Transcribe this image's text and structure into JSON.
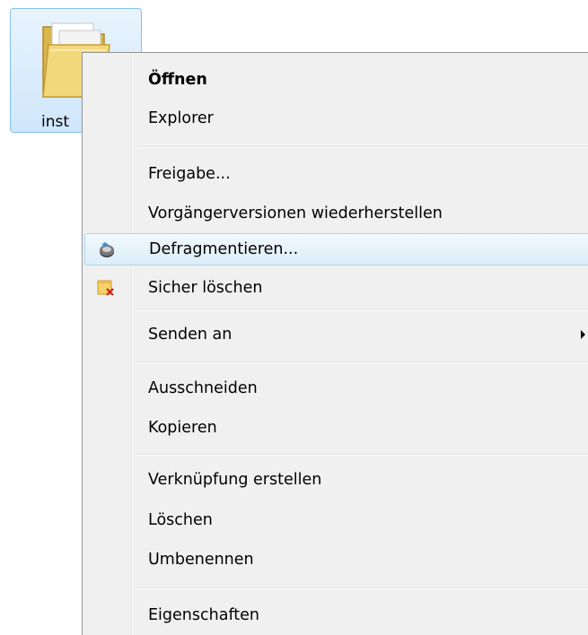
{
  "desktop": {
    "folder_label": "inst"
  },
  "context_menu": {
    "items": [
      {
        "label": "Öffnen"
      },
      {
        "label": "Explorer"
      },
      {
        "label": "Freigabe..."
      },
      {
        "label": "Vorgängerversionen wiederherstellen"
      },
      {
        "label": "Defragmentieren..."
      },
      {
        "label": "Sicher löschen"
      },
      {
        "label": "Senden an"
      },
      {
        "label": "Ausschneiden"
      },
      {
        "label": "Kopieren"
      },
      {
        "label": "Verknüpfung erstellen"
      },
      {
        "label": "Löschen"
      },
      {
        "label": "Umbenennen"
      },
      {
        "label": "Eigenschaften"
      }
    ],
    "icons": {
      "defragment": "defragment-icon",
      "secure_delete": "secure-delete-icon",
      "submenu": "submenu-arrow-icon"
    },
    "colors": {
      "background": "#f0f0f0",
      "border": "#979797",
      "highlight_border": "#a8d8eb",
      "highlight_fill": "#dcedf8"
    }
  }
}
